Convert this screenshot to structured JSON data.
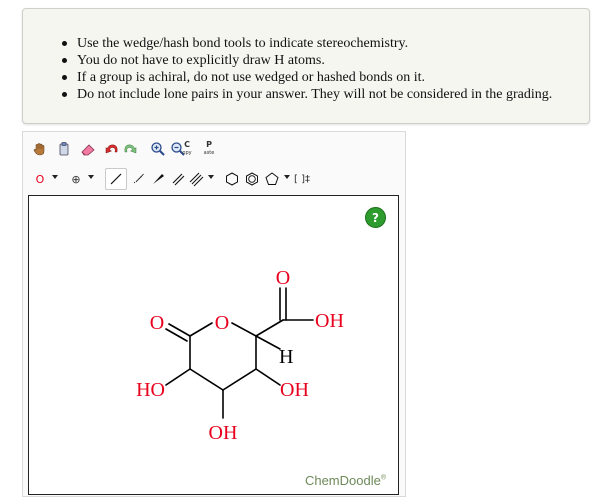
{
  "instructions": [
    "Use the wedge/hash bond tools to indicate stereochemistry.",
    "You do not have to explicitly draw H atoms.",
    "If a group is achiral, do not use wedged or hashed bonds on it.",
    "Do not include lone pairs in your answer. They will not be considered in the grading."
  ],
  "toolbar": {
    "copy_label_top": "C",
    "copy_label_bottom": "opy",
    "paste_label_top": "P",
    "paste_label_bottom": "aste",
    "atom_selector": "O",
    "charge_label": "⊕",
    "bracket_label": "[ ]‡"
  },
  "molecule": {
    "atoms": {
      "ring_o": "O",
      "carbonyl_o": "O",
      "acid_o": "O",
      "acid_oh": "OH",
      "h": "H",
      "left_oh": "HO",
      "right_oh": "OH",
      "bottom_oh": "OH"
    }
  },
  "canvas": {
    "help": "?",
    "brand": "ChemDoodle",
    "brand_mark": "®"
  },
  "colors": {
    "oxygen": "#e8001c",
    "bond": "#000000",
    "help_green": "#2e9b2e",
    "panel_bg": "#f5f6f0"
  }
}
